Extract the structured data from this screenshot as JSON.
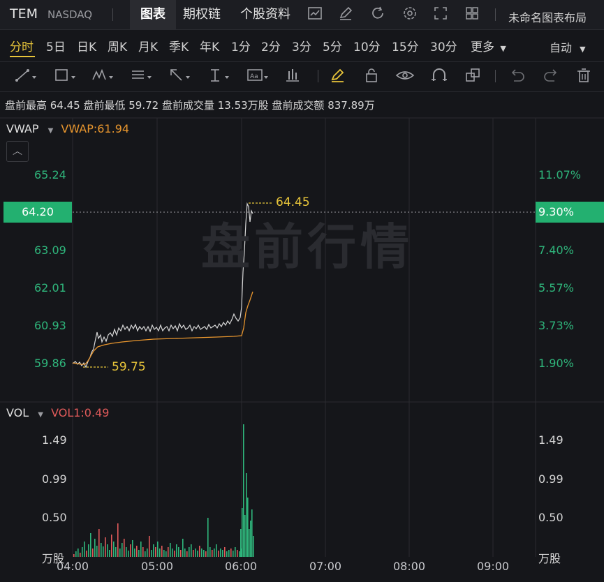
{
  "header": {
    "ticker": "TEM",
    "exchange": "NASDAQ",
    "tabs": [
      "图表",
      "期权链",
      "个股资料"
    ],
    "active_tab": "图表",
    "layout_name": "未命名图表布局",
    "tool_icons": [
      "line-chart-icon",
      "edit-icon",
      "refresh-icon",
      "settings-icon",
      "fullscreen-icon",
      "grid-layout-icon"
    ]
  },
  "periods": {
    "items": [
      "分时",
      "5日",
      "日K",
      "周K",
      "月K",
      "季K",
      "年K",
      "1分",
      "2分",
      "3分",
      "5分",
      "10分",
      "15分",
      "30分",
      "更多"
    ],
    "active": "分时",
    "auto_label": "自动"
  },
  "stats": {
    "text": "盘前最高 64.45 盘前最低 59.72 盘前成交量 13.53万股 盘前成交额 837.89万"
  },
  "main_chart": {
    "indicator": "VWAP",
    "indicator_value": "VWAP:61.94",
    "watermark": "盘前行情",
    "high_label": "64.45",
    "low_label": "59.75",
    "current_price": "64.20",
    "current_pct": "9.30%",
    "price_ticks": [
      "65.24",
      "63.09",
      "62.01",
      "60.93",
      "59.86"
    ],
    "pct_ticks": [
      "11.07%",
      "7.40%",
      "5.57%",
      "3.73%",
      "1.90%"
    ]
  },
  "vol_chart": {
    "indicator": "VOL",
    "indicator_value": "VOL1:0.49",
    "ticks": [
      "1.49",
      "0.99",
      "0.50"
    ],
    "unit": "万股"
  },
  "x_ticks": [
    "04:00",
    "05:00",
    "06:00",
    "07:00",
    "08:00",
    "09:00"
  ],
  "colors": {
    "up": "#2fb67c",
    "down": "#e05a5a",
    "vwap": "#e8962e",
    "price_line": "#d8d8d8",
    "accent": "#e8c53a"
  }
}
